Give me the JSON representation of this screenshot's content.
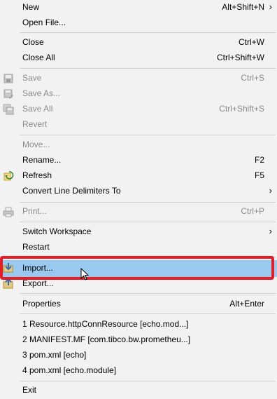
{
  "menu": {
    "new": {
      "label": "New",
      "shortcut": "Alt+Shift+N"
    },
    "open_file": {
      "label": "Open File..."
    },
    "close": {
      "label": "Close",
      "shortcut": "Ctrl+W"
    },
    "close_all": {
      "label": "Close All",
      "shortcut": "Ctrl+Shift+W"
    },
    "save": {
      "label": "Save",
      "shortcut": "Ctrl+S",
      "icon": "save-icon"
    },
    "save_as": {
      "label": "Save As...",
      "icon": "save-as-icon"
    },
    "save_all": {
      "label": "Save All",
      "shortcut": "Ctrl+Shift+S",
      "icon": "save-all-icon"
    },
    "revert": {
      "label": "Revert"
    },
    "move": {
      "label": "Move..."
    },
    "rename": {
      "label": "Rename...",
      "shortcut": "F2"
    },
    "refresh": {
      "label": "Refresh",
      "shortcut": "F5",
      "icon": "refresh-icon"
    },
    "convert": {
      "label": "Convert Line Delimiters To"
    },
    "print": {
      "label": "Print...",
      "shortcut": "Ctrl+P",
      "icon": "print-icon"
    },
    "switch_workspace": {
      "label": "Switch Workspace"
    },
    "restart": {
      "label": "Restart"
    },
    "import": {
      "label": "Import...",
      "icon": "import-icon"
    },
    "export": {
      "label": "Export...",
      "icon": "export-icon"
    },
    "properties": {
      "label": "Properties",
      "shortcut": "Alt+Enter"
    },
    "recent": [
      "1 Resource.httpConnResource  [echo.mod...]",
      "2 MANIFEST.MF  [com.tibco.bw.prometheu...]",
      "3 pom.xml  [echo]",
      "4 pom.xml  [echo.module]"
    ],
    "exit": {
      "label": "Exit"
    }
  },
  "colors": {
    "background": "#f2f2f2",
    "highlight": "#99c9ef",
    "annotation": "#e81c24",
    "disabled_text": "#8a8a8a"
  }
}
